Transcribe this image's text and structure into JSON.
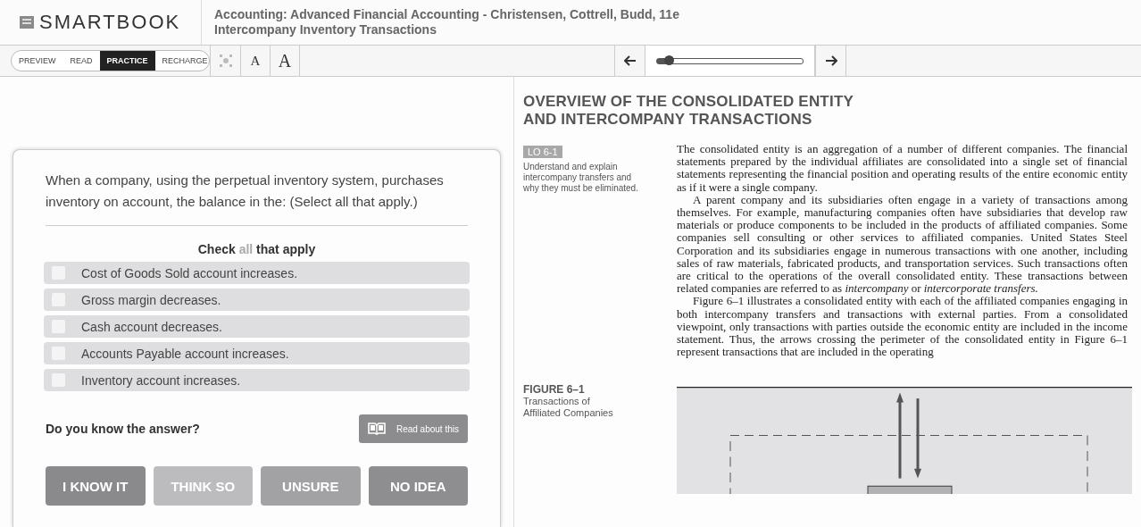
{
  "header": {
    "logo": "SMARTBOOK",
    "title": "Accounting: Advanced Financial Accounting - Christensen, Cottrell, Budd, 11e",
    "subtitle": "Intercompany Inventory Transactions"
  },
  "steps": [
    {
      "label": "PREVIEW",
      "selected": false
    },
    {
      "label": "READ",
      "selected": false
    },
    {
      "label": "PRACTICE",
      "selected": true
    },
    {
      "label": "RECHARGE",
      "selected": false
    }
  ],
  "font_buttons": [
    "A",
    "A"
  ],
  "pager": {
    "level": 0.08
  },
  "question": {
    "prompt": "When a company, using the perpetual inventory system, purchases inventory on account, the balance in the: (Select all that apply.)",
    "instruction": {
      "before": "Check",
      "emphasis": "all",
      "after": "that apply"
    },
    "options": [
      {
        "label": "Cost of Goods Sold account increases.",
        "checked": false
      },
      {
        "label": "Gross margin decreases.",
        "checked": false
      },
      {
        "label": "Cash account decreases.",
        "checked": false
      },
      {
        "label": "Accounts Payable account increases.",
        "checked": false
      },
      {
        "label": "Inventory account increases.",
        "checked": false
      }
    ],
    "confidence_prompt": "Do you know the answer?",
    "read_button": "Read about this",
    "confidence": [
      {
        "label": "I KNOW IT",
        "color": "#8a8a8c"
      },
      {
        "label": "THINK SO",
        "color": "#bcbcbe"
      },
      {
        "label": "UNSURE",
        "color": "#a2a2a4"
      },
      {
        "label": "NO IDEA",
        "color": "#8e8e90"
      }
    ]
  },
  "reading": {
    "heading": [
      "OVERVIEW OF THE CONSOLIDATED ENTITY",
      "AND INTERCOMPANY TRANSACTIONS"
    ],
    "objective": {
      "tag": "LO 6-1",
      "text": "Understand and explain intercompany transfers and why they must be eliminated."
    },
    "paragraphs": [
      {
        "text": "The consolidated entity is an aggregation of a number of different companies. The financial statements prepared by the individual affiliates are consolidated into a single set of financial statements representing the financial position and operating results of the entire economic entity as if it were a single company.",
        "indent": false
      },
      {
        "text": "A parent company and its subsidiaries often engage in a variety of transactions among themselves. For example, manufacturing companies often have subsidiaries that develop raw materials or produce components to be included in the products of affiliated companies. Some companies sell consulting or other services to affiliated companies. United States Steel Corporation and its subsidiaries engage in numerous transactions with one another, including sales of raw materials, fabricated products, and transportation services. Such transactions often are critical to the operations of the overall consolidated entity. These transactions between related companies are referred to as *intercompany* or *intercorporate transfers.*",
        "indent": true
      },
      {
        "text": "Figure 6–1 illustrates a consolidated entity with each of the affiliated companies engaging in both intercompany transfers and transactions with external parties. From a consolidated viewpoint, only transactions with parties outside the economic entity are included in the income statement. Thus, the arrows crossing the perimeter of the consolidated entity in Figure 6–1 represent transactions that are included in the operating",
        "indent": true
      }
    ],
    "figure": {
      "label": "FIGURE 6–1",
      "caption": "Transactions of Affiliated Companies"
    }
  }
}
